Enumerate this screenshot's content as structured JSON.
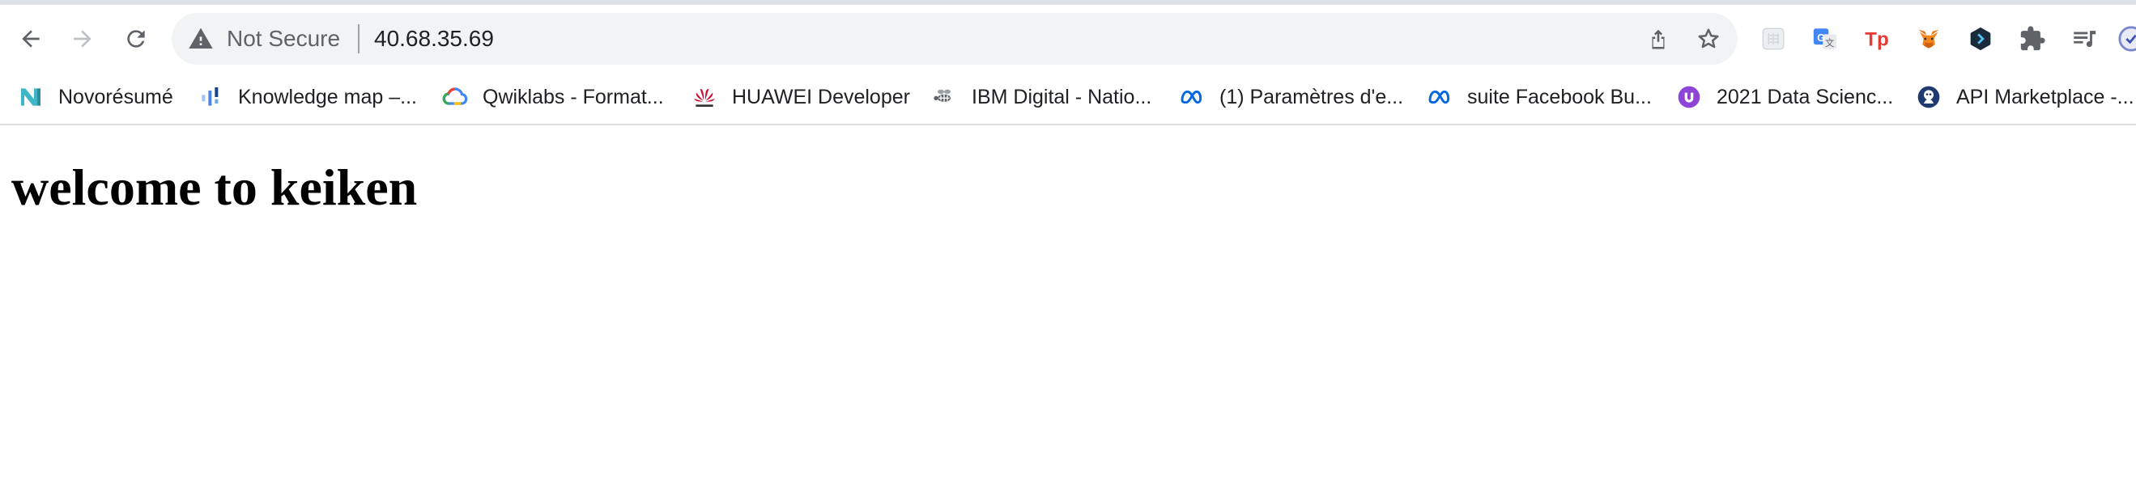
{
  "toolbar": {
    "back_icon": "arrow-left-icon",
    "forward_icon": "arrow-right-icon",
    "reload_icon": "reload-icon"
  },
  "omnibox": {
    "security_icon": "warning-triangle-icon",
    "security_status": "Not Secure",
    "url": "40.68.35.69",
    "share_icon": "share-icon",
    "bookmark_icon": "star-icon"
  },
  "extensions": [
    {
      "name": "grid-extension-icon"
    },
    {
      "name": "google-translate-icon"
    },
    {
      "name": "tp-extension-icon"
    },
    {
      "name": "metamask-fox-icon"
    },
    {
      "name": "hexagon-extension-icon"
    },
    {
      "name": "puzzle-extensions-icon"
    },
    {
      "name": "media-queue-icon"
    },
    {
      "name": "profile-avatar-icon"
    }
  ],
  "bookmarks": [
    {
      "label": "Novorésumé",
      "icon": "novoresume-icon",
      "color": "#3fb5c8"
    },
    {
      "label": "Knowledge map –...",
      "icon": "knowledge-map-icon",
      "color": "#4a86e8"
    },
    {
      "label": "Qwiklabs - Format...",
      "icon": "google-cloud-icon",
      "color": "#4285f4"
    },
    {
      "label": "HUAWEI Developer",
      "icon": "huawei-icon",
      "color": "#cf0a2c"
    },
    {
      "label": "IBM Digital - Natio...",
      "icon": "ibm-bee-icon",
      "color": "#5f6368"
    },
    {
      "label": "(1) Paramètres d'e...",
      "icon": "meta-icon",
      "color": "#0668e1"
    },
    {
      "label": "suite Facebook Bu...",
      "icon": "meta-icon",
      "color": "#0668e1"
    },
    {
      "label": "2021 Data Scienc...",
      "icon": "data-science-icon",
      "color": "#8e44d6"
    },
    {
      "label": "API Marketplace -...",
      "icon": "api-marketplace-icon",
      "color": "#1f3a6e"
    }
  ],
  "page": {
    "heading": "welcome to keiken"
  },
  "colors": {
    "chrome_bg": "#ffffff",
    "omnibox_bg": "#f1f3f4",
    "text_primary": "#202124",
    "text_secondary": "#5f6368"
  }
}
